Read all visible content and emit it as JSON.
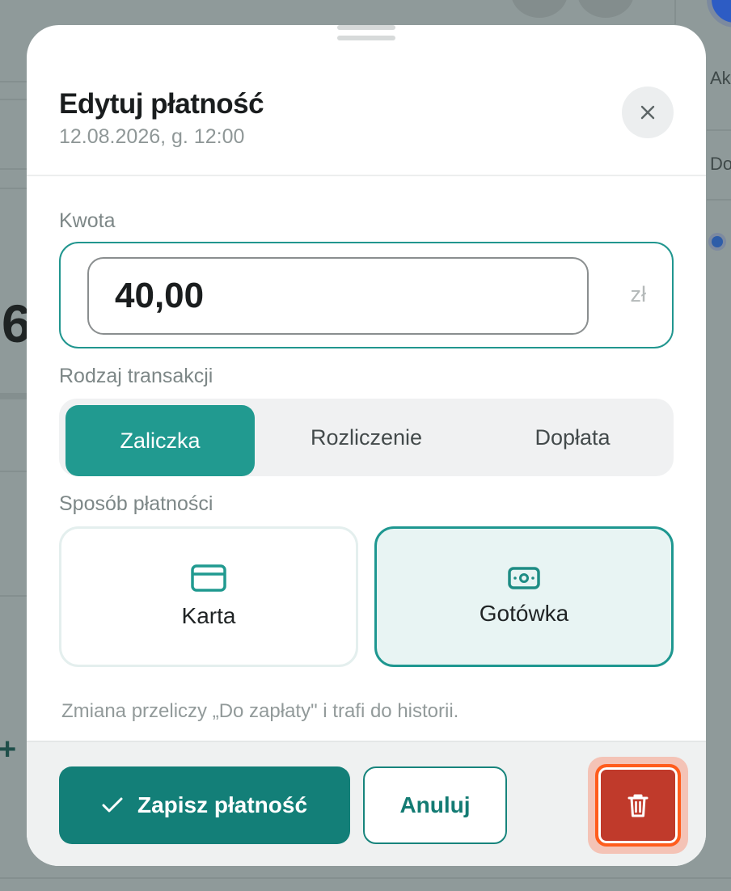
{
  "background": {
    "tab_label_top": "Ak",
    "row_label": "Do",
    "big_digit": "6",
    "plus_icon": "plus-icon"
  },
  "modal": {
    "title": "Edytuj płatność",
    "subtitle": "12.08.2026, g. 12:00",
    "close_icon": "close-icon",
    "amount": {
      "label": "Kwota",
      "value": "40,00",
      "currency": "zł"
    },
    "transaction_type": {
      "label": "Rodzaj transakcji",
      "options": [
        "Zaliczka",
        "Rozliczenie",
        "Dopłata"
      ],
      "selected": "Zaliczka"
    },
    "payment_method": {
      "label": "Sposób płatności",
      "options": [
        {
          "label": "Karta",
          "icon": "credit-card-icon"
        },
        {
          "label": "Gotówka",
          "icon": "cash-icon"
        }
      ],
      "selected": "Gotówka"
    },
    "note": "Zmiana przeliczy „Do zapłaty\" i trafi do historii.",
    "footer": {
      "save_label": "Zapisz płatność",
      "cancel_label": "Anuluj",
      "delete_icon": "trash-icon"
    }
  },
  "colors": {
    "accent": "#219a90",
    "accent_dark": "#137f78",
    "danger": "#c03a2b",
    "danger_ring": "#ff5c1c"
  }
}
